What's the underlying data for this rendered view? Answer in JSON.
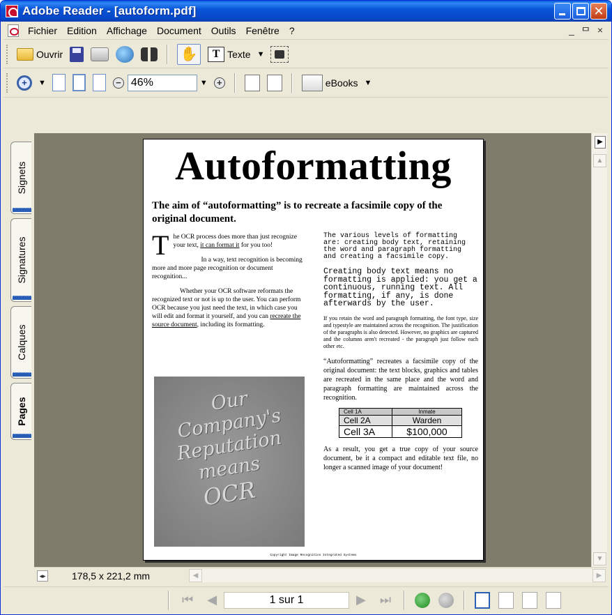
{
  "window": {
    "title": "Adobe Reader - [autoform.pdf]"
  },
  "menu": {
    "items": [
      "Fichier",
      "Edition",
      "Affichage",
      "Document",
      "Outils",
      "Fenêtre",
      "?"
    ],
    "mdi_min": "_",
    "mdi_restore": "ᄆ",
    "mdi_close": "×"
  },
  "toolbar1": {
    "open_label": "Ouvrir",
    "text_tool_label": "Texte",
    "icons": [
      "folder-open-icon",
      "save-icon",
      "print-icon",
      "email-icon",
      "search-binoculars-icon",
      "hand-icon",
      "text-select-icon",
      "snapshot-icon"
    ]
  },
  "toolbar2": {
    "zoom_value": "46%",
    "ebooks_label": "eBooks",
    "icons": [
      "zoom-in-icon",
      "actual-size-icon",
      "fit-page-icon",
      "fit-width-icon",
      "zoom-out-icon",
      "zoom-increase-icon",
      "rotate-cw-icon",
      "rotate-ccw-icon",
      "ebooks-icon"
    ]
  },
  "nav_tabs": [
    {
      "label": "Signets",
      "active": false
    },
    {
      "label": "Signatures",
      "active": false
    },
    {
      "label": "Calques",
      "active": false
    },
    {
      "label": "Pages",
      "active": true
    }
  ],
  "document": {
    "title": "Autoformatting",
    "lead": "The aim of “autoformatting” is to recreate a facsimile copy of the original document.",
    "left_col": {
      "dropcap": "T",
      "p1_text": "he OCR process does more than just recognize your text, ",
      "p1_link": "it can format it",
      "p1_tail": " for you too!",
      "p2": "In a way, text recognition is becoming more and more page recognition or document recognition...",
      "p3_text": "Whether your OCR software reformats the recognized text or not is up to the user. You can perform OCR because you just need the text, in which case you will edit and format it yourself, and you can ",
      "p3_link": "recreate the source document",
      "p3_tail": ", including its formatting.",
      "image_lines": [
        "Our",
        "Company's",
        "Reputation",
        "means",
        "OCR"
      ]
    },
    "right_col": {
      "mono1": "The various levels of formatting are: creating body text, retaining the word and paragraph formatting and creating a facsimile copy.",
      "mono2": "Creating body text means no formatting is applied: you get a continuous, running text. All formatting, if any, is done afterwards by the user.",
      "small_text": "If you retain the word and paragraph formatting, the font type, size and typestyle are maintained across the recognition. The justification of the paragraphs is also detected. However, no graphics are captured and the columns aren't recreated - the paragraph just follow each other etc.",
      "mid_text": "“Autoformatting” recreates a facsimile copy of the original document: the text blocks, graphics and tables are recreated in the same place and the word and paragraph formatting are maintained across the recognition.",
      "table": [
        [
          "Cell 1A",
          "Inmate"
        ],
        [
          "Cell 2A",
          "Warden"
        ],
        [
          "Cell 3A",
          "$100,000"
        ]
      ],
      "closing": "As a result, you get a true copy of your source document, be it a compact and editable text file, no longer a scanned image of your document!"
    },
    "footer": "Copyright Image Recognition Integrated Systems"
  },
  "status": {
    "dimensions": "178,5 x 221,2 mm"
  },
  "navbar": {
    "page_indicator": "1 sur 1"
  }
}
